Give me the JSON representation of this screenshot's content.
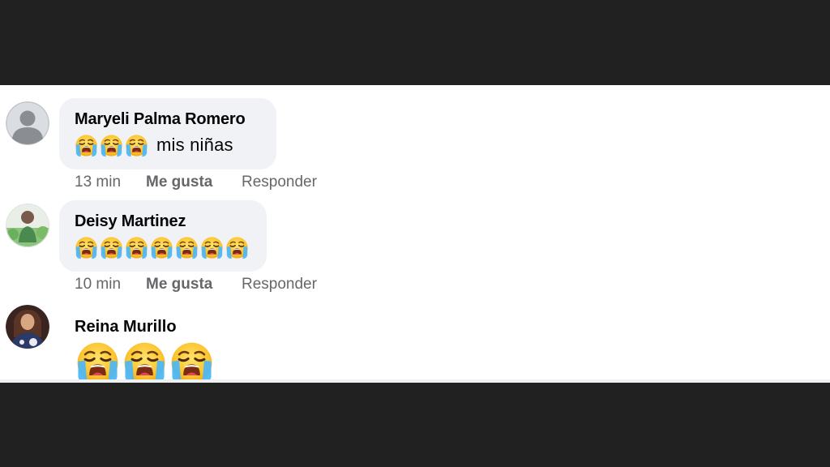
{
  "comments": [
    {
      "author": "Maryeli Palma Romero",
      "emoji_count": 3,
      "emoji_name": "loudly-crying-face-icon",
      "text": "mis niñas",
      "time": "13 min",
      "like": "Me gusta",
      "reply": "Responder"
    },
    {
      "author": "Deisy Martinez",
      "emoji_count": 7,
      "emoji_name": "loudly-crying-face-icon",
      "text": "",
      "time": "10 min",
      "like": "Me gusta",
      "reply": "Responder"
    },
    {
      "author": "Reina Murillo",
      "emoji_count": 3,
      "emoji_name": "loudly-crying-face-icon",
      "text": ""
    }
  ],
  "colors": {
    "frame": "#212121",
    "bubble": "#f0f2f5",
    "name_text": "#050505",
    "meta_text": "#65676b"
  }
}
